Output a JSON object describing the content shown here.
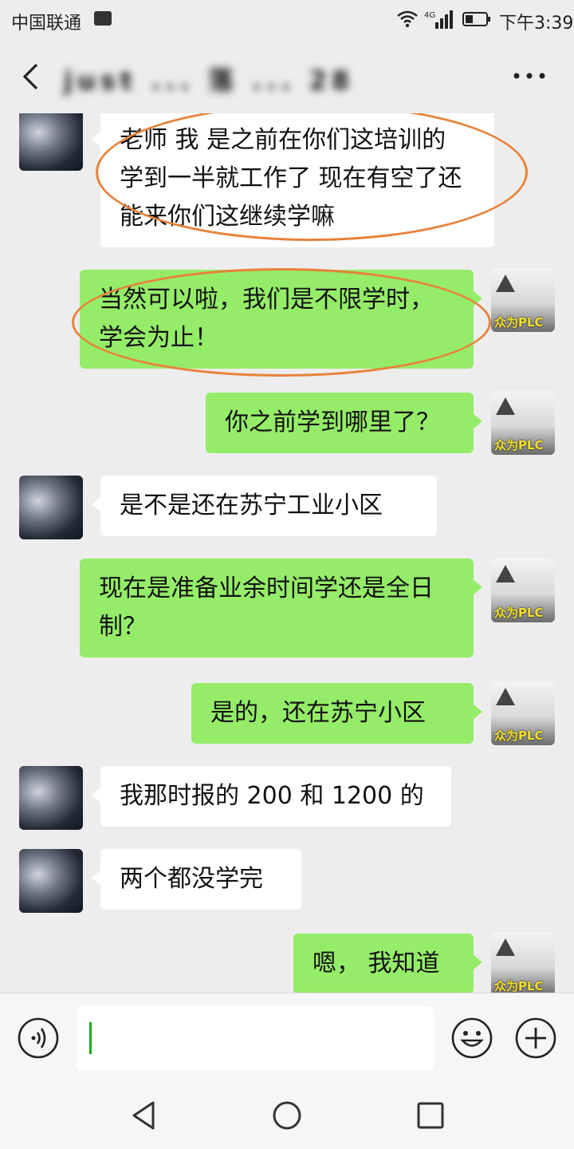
{
  "status_bar": {
    "carrier": "中国联通",
    "network": "4G",
    "time": "下午3:39"
  },
  "header": {
    "title": "just ... 落 ... 28",
    "more_label": "..."
  },
  "messages": [
    {
      "side": "left",
      "text": "老师 我 是之前在你们这培训的 学到一半就工作了 现在有空了还能来你们这继续学嘛"
    },
    {
      "side": "right",
      "text": "当然可以啦，我们是不限学时，学会为止！"
    },
    {
      "side": "right",
      "text": "你之前学到哪里了？"
    },
    {
      "side": "left",
      "text": "是不是还在苏宁工业小区"
    },
    {
      "side": "right",
      "text": "现在是准备业余时间学还是全日制？"
    },
    {
      "side": "right",
      "text": "是的，还在苏宁小区"
    },
    {
      "side": "left",
      "text": "我那时报的 200 和 1200 的"
    },
    {
      "side": "left",
      "text": "两个都没学完"
    },
    {
      "side": "right",
      "text": "嗯， 我知道"
    }
  ],
  "avatar": {
    "right_brand": "众为PLC"
  },
  "input": {
    "value": "",
    "placeholder": ""
  },
  "colors": {
    "background": "#ededed",
    "bubble_right": "#95ec69",
    "bubble_left": "#ffffff",
    "highlight": "#e8823a"
  },
  "icons": {
    "back": "back-chevron-icon",
    "more": "more-dots-icon",
    "voice": "voice-icon",
    "emoji": "emoji-icon",
    "plus": "plus-icon"
  }
}
